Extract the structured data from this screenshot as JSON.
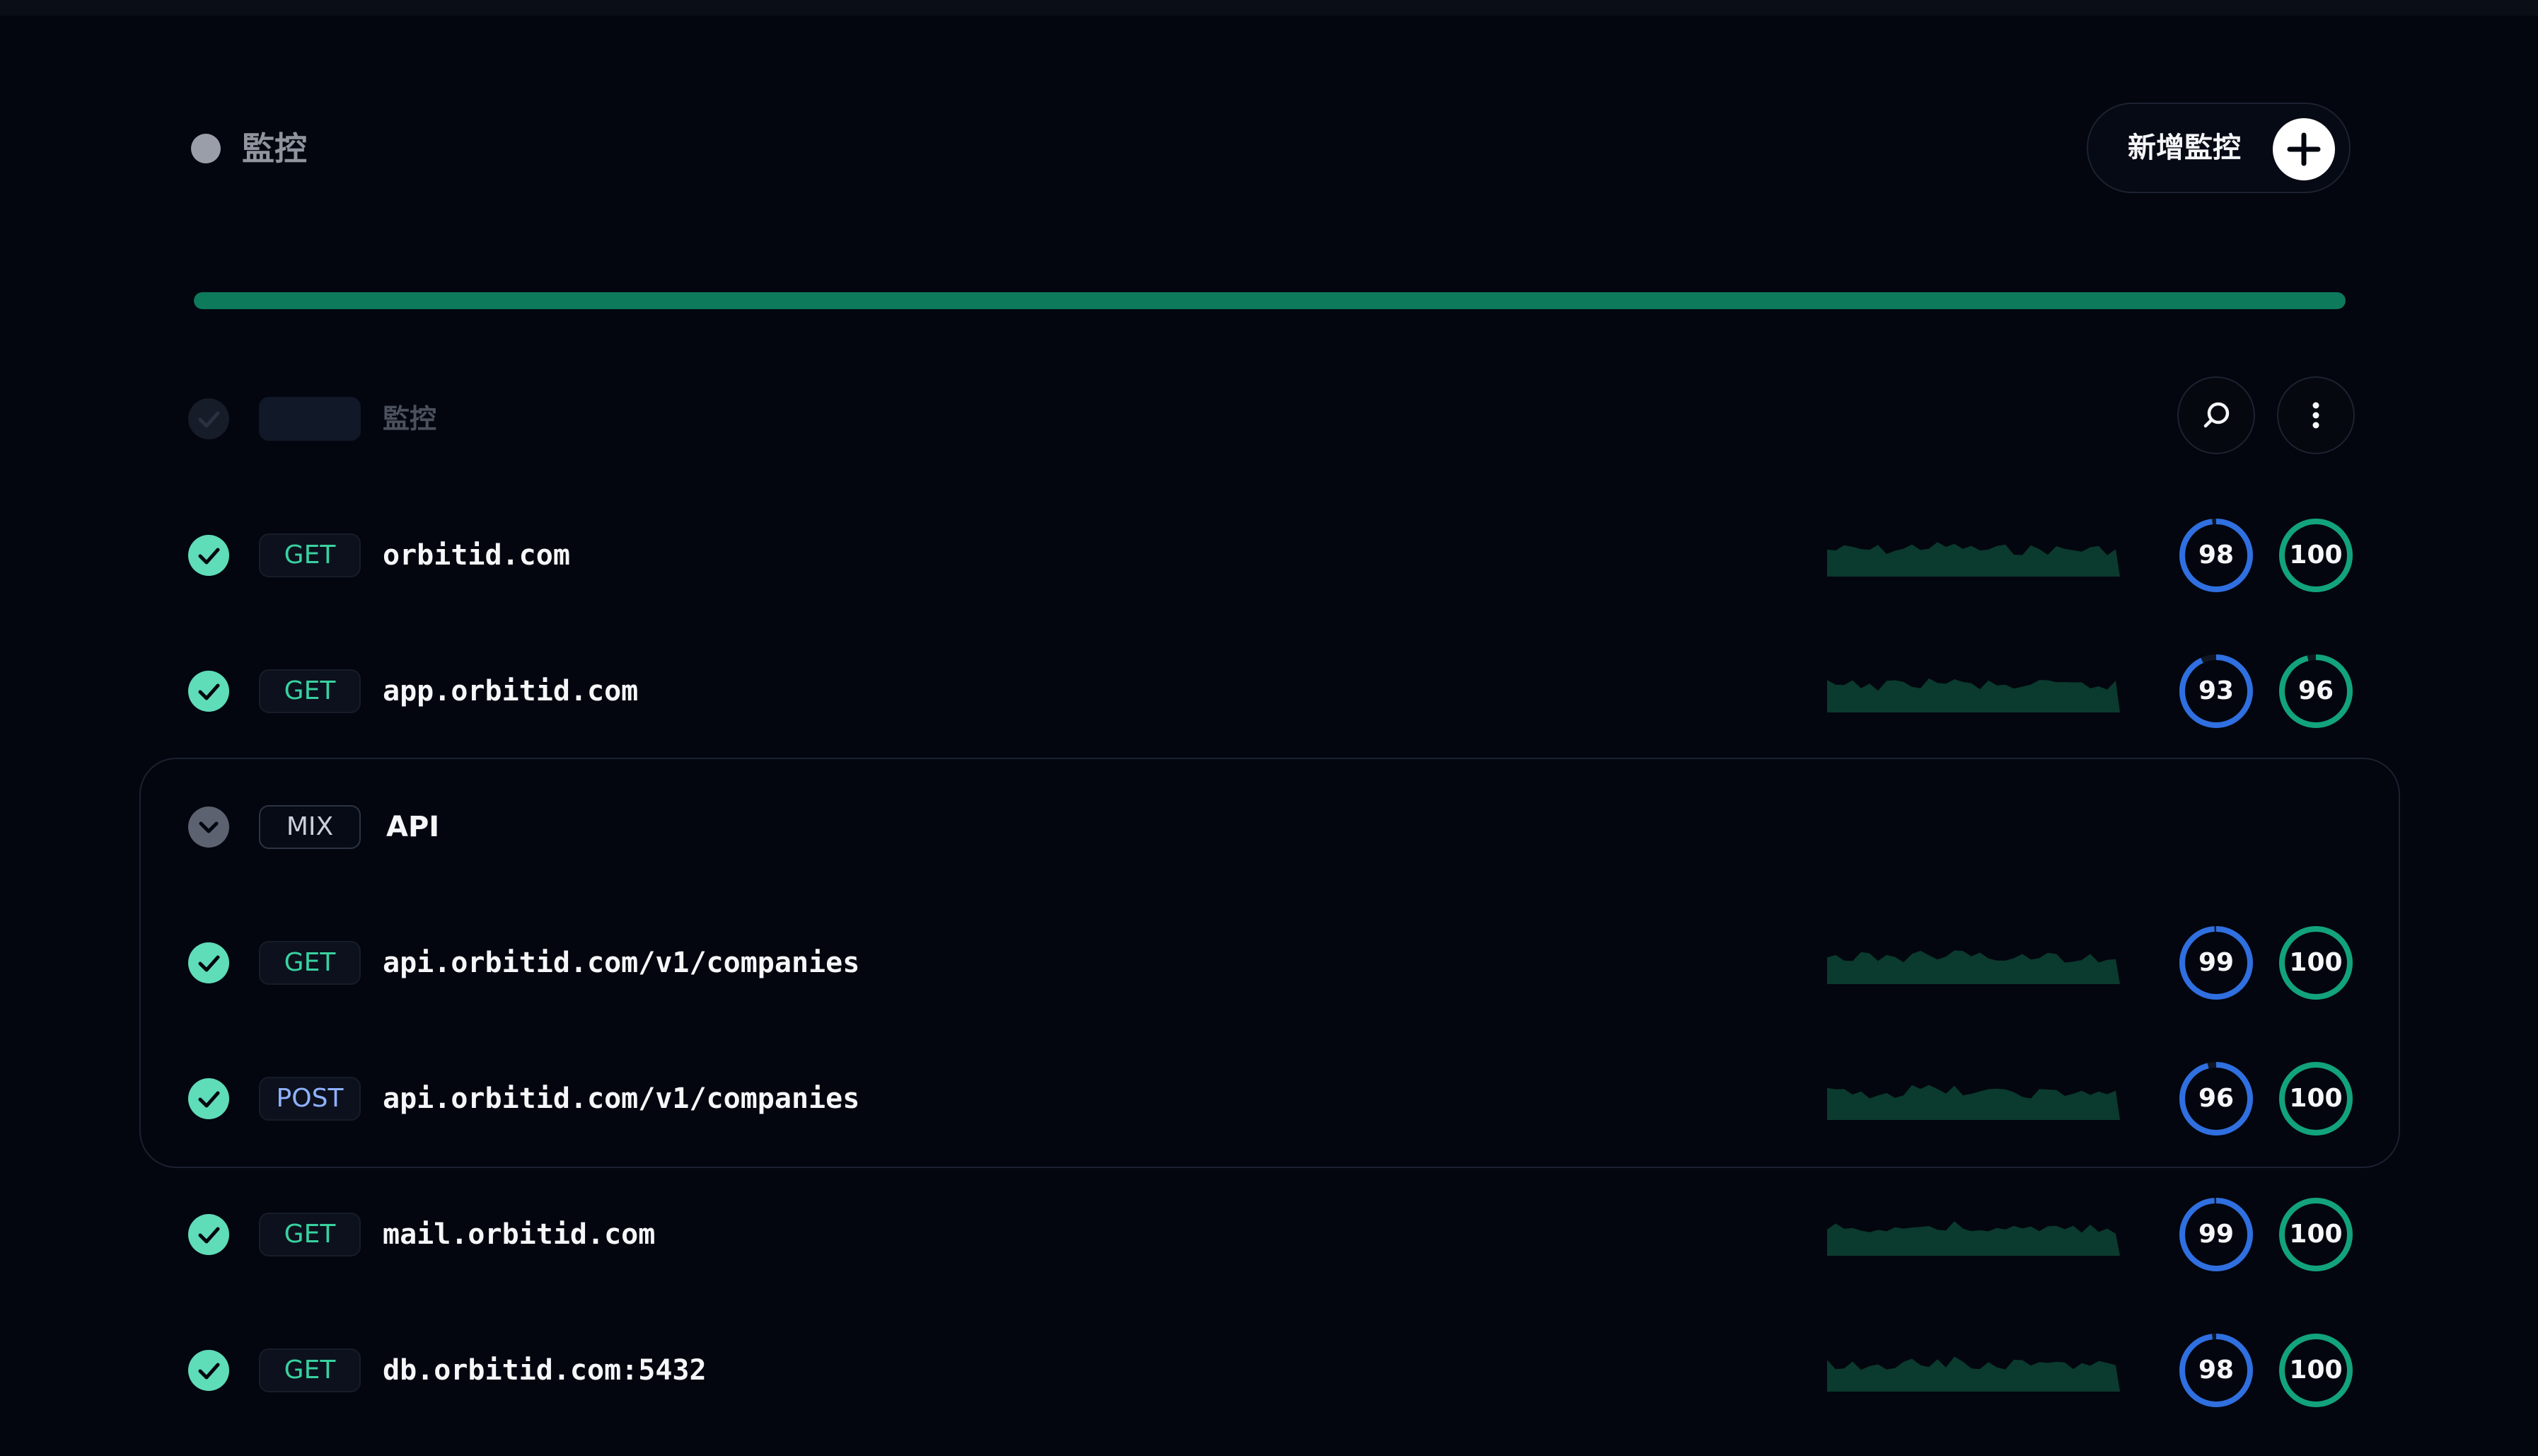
{
  "header": {
    "title": "監控",
    "add_button_label": "新增監控"
  },
  "status_bar": {
    "uptime_fraction": 1.0,
    "color": "#0d7a5c"
  },
  "list_header": {
    "title": "監控"
  },
  "rows": [
    {
      "method": "GET",
      "name": "orbitid.com",
      "performance": "98",
      "availability": "100"
    },
    {
      "method": "GET",
      "name": "app.orbitid.com",
      "performance": "93",
      "availability": "96"
    },
    {
      "method": "MIX",
      "name": "API"
    },
    {
      "method": "GET",
      "name": "api.orbitid.com/v1/companies",
      "performance": "99",
      "availability": "100"
    },
    {
      "method": "POST",
      "name": "api.orbitid.com/v1/companies",
      "performance": "96",
      "availability": "100"
    },
    {
      "method": "GET",
      "name": "mail.orbitid.com",
      "performance": "99",
      "availability": "100"
    },
    {
      "method": "GET",
      "name": "db.orbitid.com:5432",
      "performance": "98",
      "availability": "100"
    }
  ],
  "colors": {
    "up": "#5fdcb8",
    "get": "#39d1a0",
    "post": "#8fb2ff",
    "performance_ring": "#2f6fe0",
    "availability_ring": "#12a37c",
    "sparkline": "#0b3a2e"
  }
}
